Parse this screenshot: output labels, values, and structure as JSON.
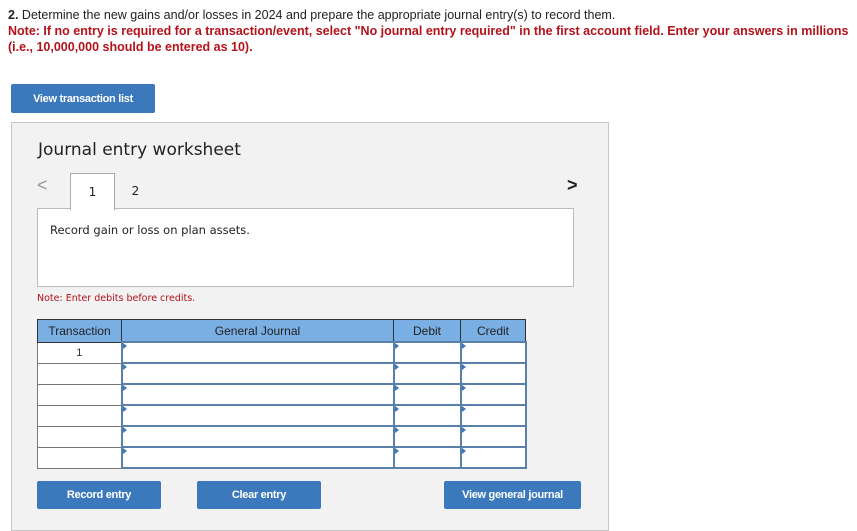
{
  "question": {
    "number": "2.",
    "text": "Determine the new gains and/or losses in 2024 and prepare the appropriate journal entry(s) to record them.",
    "note": "Note: If no entry is required for a transaction/event, select \"No journal entry required\" in the first account field. Enter your answers in millions (i.e., 10,000,000 should be entered as 10)."
  },
  "buttons": {
    "view_transaction_list": "View transaction list",
    "record_entry": "Record entry",
    "clear_entry": "Clear entry",
    "view_general_journal": "View general journal"
  },
  "worksheet": {
    "title": "Journal entry worksheet",
    "tabs": [
      {
        "label": "1",
        "active": true
      },
      {
        "label": "2",
        "active": false
      }
    ],
    "prev_glyph": "<",
    "next_glyph": ">",
    "description": "Record gain or loss on plan assets.",
    "debit_note": "Note: Enter debits before credits."
  },
  "table": {
    "headers": [
      "Transaction",
      "General Journal",
      "Debit",
      "Credit"
    ],
    "rows": [
      {
        "transaction": "1",
        "account": "",
        "debit": "",
        "credit": ""
      },
      {
        "transaction": "",
        "account": "",
        "debit": "",
        "credit": ""
      },
      {
        "transaction": "",
        "account": "",
        "debit": "",
        "credit": ""
      },
      {
        "transaction": "",
        "account": "",
        "debit": "",
        "credit": ""
      },
      {
        "transaction": "",
        "account": "",
        "debit": "",
        "credit": ""
      },
      {
        "transaction": "",
        "account": "",
        "debit": "",
        "credit": ""
      }
    ]
  },
  "colors": {
    "accent": "#3b78bc",
    "header_blue": "#7aafe3",
    "note_red": "#b3121a",
    "panel_bg": "#f2f2f2"
  }
}
